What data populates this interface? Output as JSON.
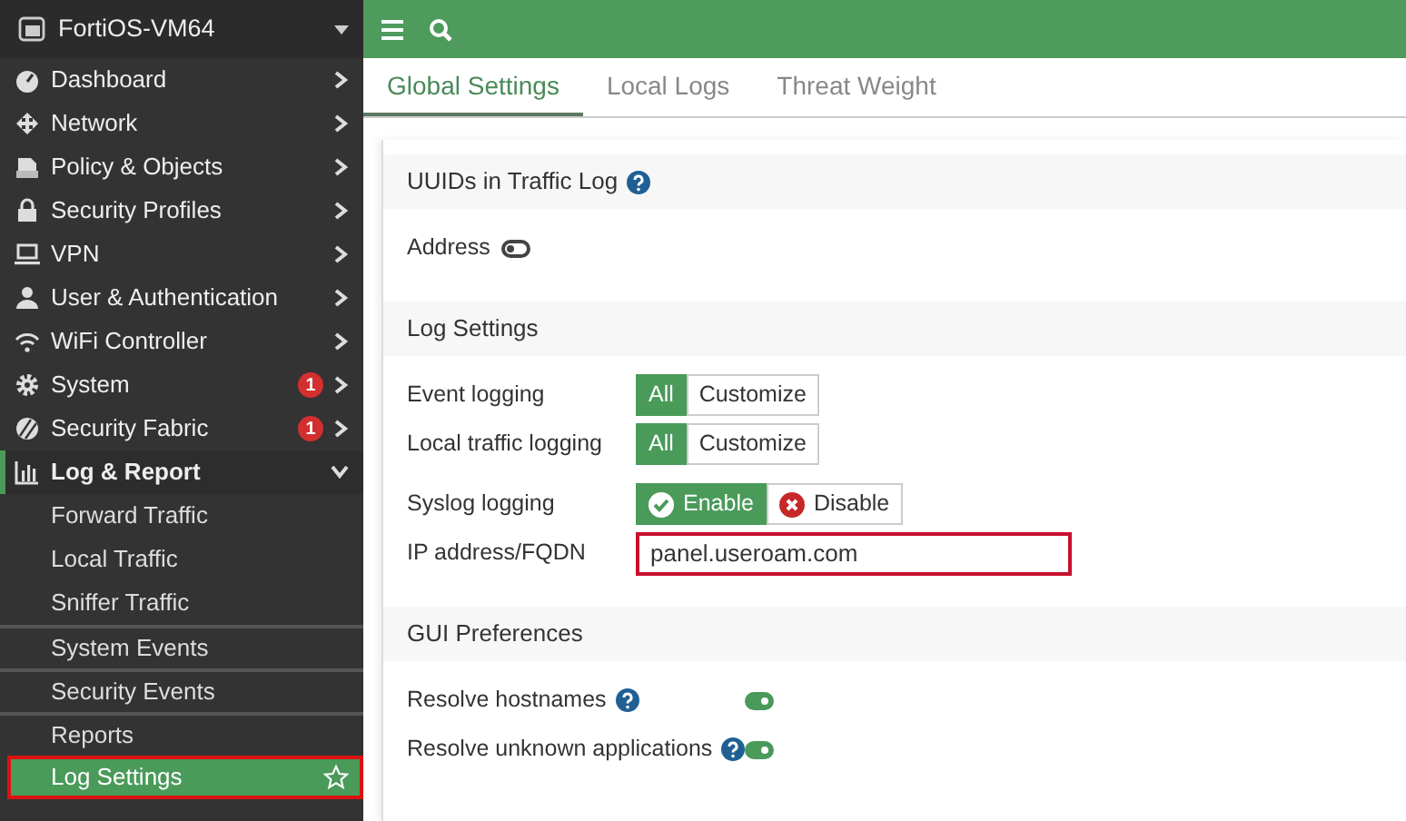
{
  "sidebar": {
    "title": "FortiOS-VM64",
    "items": [
      {
        "label": "Dashboard",
        "expanded": false
      },
      {
        "label": "Network",
        "expanded": false
      },
      {
        "label": "Policy & Objects",
        "expanded": false
      },
      {
        "label": "Security Profiles",
        "expanded": false
      },
      {
        "label": "VPN",
        "expanded": false
      },
      {
        "label": "User & Authentication",
        "expanded": false
      },
      {
        "label": "WiFi Controller",
        "expanded": false
      },
      {
        "label": "System",
        "badge": "1",
        "expanded": false
      },
      {
        "label": "Security Fabric",
        "badge": "1",
        "expanded": false
      },
      {
        "label": "Log & Report",
        "expanded": true,
        "children": [
          {
            "label": "Forward Traffic",
            "selected": false,
            "divider_above": false,
            "highlighted": false
          },
          {
            "label": "Local Traffic",
            "selected": false,
            "divider_above": false,
            "highlighted": false
          },
          {
            "label": "Sniffer Traffic",
            "selected": false,
            "divider_above": false,
            "highlighted": false
          },
          {
            "label": "System Events",
            "selected": false,
            "divider_above": true,
            "highlighted": false
          },
          {
            "label": "Security Events",
            "selected": false,
            "divider_above": true,
            "highlighted": false
          },
          {
            "label": "Reports",
            "selected": false,
            "divider_above": true,
            "highlighted": false
          },
          {
            "label": "Log Settings",
            "selected": true,
            "divider_above": false,
            "highlighted": true
          }
        ]
      }
    ]
  },
  "tabs": [
    {
      "label": "Global Settings",
      "selected": true
    },
    {
      "label": "Local Logs",
      "selected": false
    },
    {
      "label": "Threat Weight",
      "selected": false
    }
  ],
  "sections": [
    {
      "title": "UUIDs in Traffic Log",
      "help": true,
      "rows": [
        {
          "kind": "toggle",
          "label": "Address",
          "help": false,
          "on": false
        }
      ]
    },
    {
      "title": "Log Settings",
      "help": false,
      "rows": [
        {
          "kind": "segmented",
          "label": "Event logging",
          "options": [
            {
              "label": "All",
              "selected": true
            },
            {
              "label": "Customize",
              "selected": false
            }
          ]
        },
        {
          "kind": "segmented",
          "label": "Local traffic logging",
          "options": [
            {
              "label": "All",
              "selected": true
            },
            {
              "label": "Customize",
              "selected": false
            }
          ]
        },
        {
          "kind": "enable_disable",
          "label": "Syslog logging",
          "options": [
            {
              "label": "Enable",
              "selected": true
            },
            {
              "label": "Disable",
              "selected": false
            }
          ]
        },
        {
          "kind": "text",
          "label": "IP address/FQDN",
          "value": "panel.useroam.com",
          "highlighted": true
        }
      ]
    },
    {
      "title": "GUI Preferences",
      "help": false,
      "rows": [
        {
          "kind": "toggle",
          "label": "Resolve hostnames",
          "help": true,
          "on": true
        },
        {
          "kind": "toggle",
          "label": "Resolve unknown applications",
          "help": true,
          "on": true
        }
      ]
    }
  ]
}
